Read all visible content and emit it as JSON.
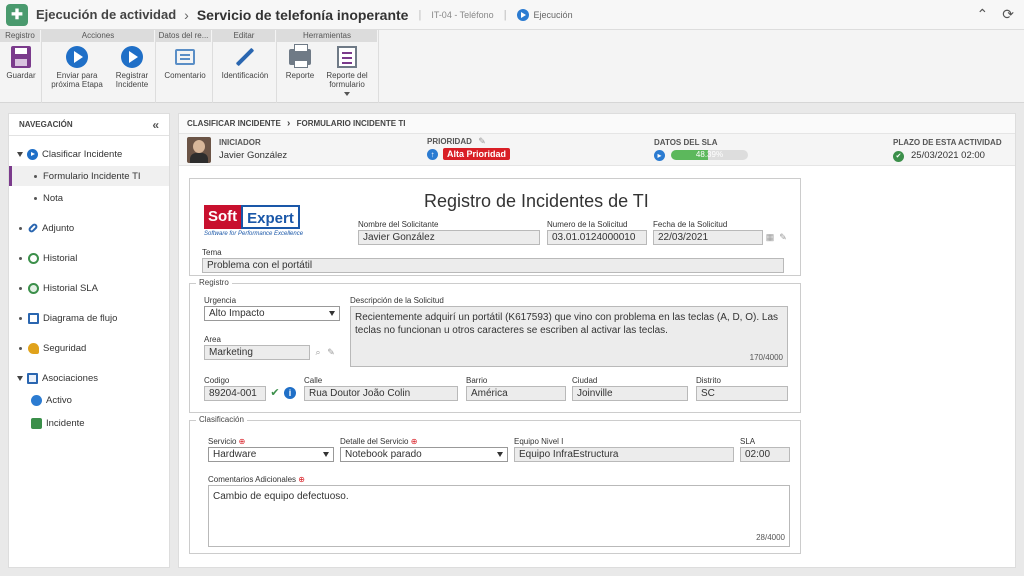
{
  "titlebar": {
    "activity": "Ejecución de actividad",
    "separator": "›",
    "subject": "Servicio de telefonía inoperante",
    "code": "IT-04 - Teléfono",
    "status": "Ejecución",
    "collapse_glyph": "⌃",
    "refresh_glyph": "⟳"
  },
  "ribbon": {
    "groups": {
      "registro": "Registro",
      "acciones": "Acciones",
      "datos": "Datos del re...",
      "editar": "Editar",
      "herramientas": "Herramientas"
    },
    "buttons": {
      "guardar": "Guardar",
      "enviar": "Enviar para próxima Etapa",
      "registrar": "Registrar Incidente",
      "comentario": "Comentario",
      "identificacion": "Identificación",
      "reporte": "Reporte",
      "reporte_form": "Reporte del formulario"
    }
  },
  "nav": {
    "header": "NAVEGACIÓN",
    "collapse": "«",
    "items": {
      "clasificar": "Clasificar Incidente",
      "formulario": "Formulario Incidente TI",
      "nota": "Nota",
      "adjunto": "Adjunto",
      "historial": "Historial",
      "historial_sla": "Historial SLA",
      "diagrama": "Diagrama de flujo",
      "seguridad": "Seguridad",
      "asociaciones": "Asociaciones",
      "activo": "Activo",
      "incidente": "Incidente"
    }
  },
  "breadcrumb": {
    "a": "CLASIFICAR INCIDENTE",
    "sep": "›",
    "b": "FORMULARIO INCIDENTE TI"
  },
  "info": {
    "iniciador_label": "INICIADOR",
    "iniciador": "Javier González",
    "prioridad_label": "PRIORIDAD",
    "prioridad": "Alta Prioridad",
    "sla_label": "DATOS DEL SLA",
    "sla_percent": 48.39,
    "sla_text": "48.39%",
    "plazo_label": "PLAZO DE ESTA ACTIVIDAD",
    "plazo": "25/03/2021 02:00"
  },
  "form": {
    "title": "Registro de Incidentes de TI",
    "logo_soft": "Soft",
    "logo_expert": "Expert",
    "logo_tag": "Software for Performance Excellence",
    "solicitante_label": "Nombre del Solicitante",
    "solicitante": "Javier González",
    "numero_label": "Numero de la Solicitud",
    "numero": "03.01.0124000010",
    "fecha_label": "Fecha de la Solicitud",
    "fecha": "22/03/2021",
    "tema_label": "Tema",
    "tema": "Problema con el portátil",
    "registro": {
      "legend": "Registro",
      "urgencia_label": "Urgencia",
      "urgencia": "Alto Impacto",
      "area_label": "Area",
      "area": "Marketing",
      "descripcion_label": "Descripción de la Solicitud",
      "descripcion": "Recientemente adquirí un portátil (K617593) que vino con problema en las teclas (A, D, O). Las teclas no funcionan u otros caracteres se escriben al activar las teclas.",
      "descripcion_count": "170/4000",
      "codigo_label": "Codigo",
      "codigo": "89204-001",
      "calle_label": "Calle",
      "calle": "Rua Doutor João Colin",
      "barrio_label": "Barrio",
      "barrio": "América",
      "ciudad_label": "Ciudad",
      "ciudad": "Joinville",
      "distrito_label": "Distrito",
      "distrito": "SC"
    },
    "clasificacion": {
      "legend": "Clasificación",
      "servicio_label": "Servicio",
      "servicio": "Hardware",
      "detalle_label": "Detalle del Servicio",
      "detalle": "Notebook parado",
      "equipo_label": "Equipo Nivel I",
      "equipo": "Equipo InfraEstructura",
      "sla_label": "SLA",
      "sla": "02:00",
      "comentarios_label": "Comentarios Adicionales",
      "comentarios": "Cambio de equipo defectuoso.",
      "comentarios_count": "28/4000"
    }
  },
  "colors": {
    "accent": "#7b3b8c",
    "primary": "#1f6fc7",
    "priority": "#d91f26",
    "sla": "#5cb85c"
  }
}
